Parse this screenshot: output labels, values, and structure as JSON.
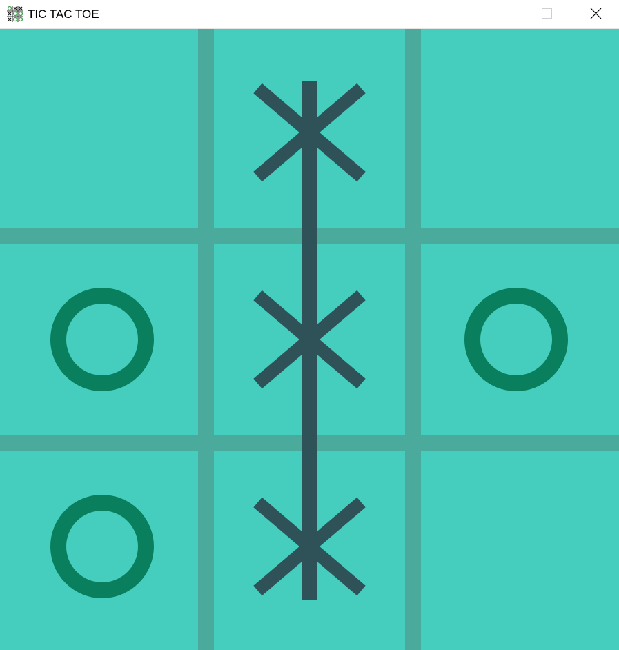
{
  "window": {
    "title": "TIC TAC TOE",
    "app_icon": "tic-tac-toe-grid-icon",
    "controls": {
      "minimize_icon": "minimize-icon",
      "maximize_icon": "maximize-icon",
      "close_icon": "close-icon"
    }
  },
  "game": {
    "board": [
      [
        "",
        "X",
        ""
      ],
      [
        "O",
        "X",
        "O"
      ],
      [
        "O",
        "X",
        ""
      ]
    ],
    "winning_line": "column-2",
    "winner": "X",
    "colors": {
      "background": "#45cebd",
      "grid_line": "#4aab9c",
      "x_mark": "#2f5158",
      "o_mark": "#0a7f5e",
      "win_line": "#2f5158"
    }
  }
}
